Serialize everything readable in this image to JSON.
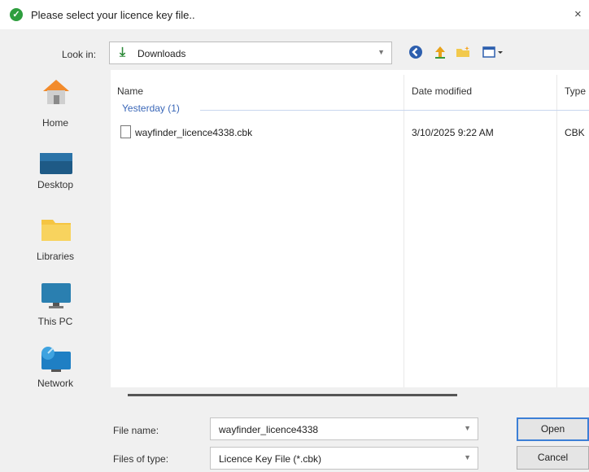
{
  "dialog": {
    "title": "Please select your licence key file..",
    "close_glyph": "×"
  },
  "toolbar": {
    "look_in_label": "Look in:",
    "look_in_value": "Downloads",
    "icons": [
      "back-icon",
      "up-folder-icon",
      "new-folder-icon",
      "view-menu-icon"
    ]
  },
  "places": [
    {
      "label": "Home",
      "icon": "home-icon"
    },
    {
      "label": "Desktop",
      "icon": "desktop-icon"
    },
    {
      "label": "Libraries",
      "icon": "libraries-icon"
    },
    {
      "label": "This PC",
      "icon": "this-pc-icon"
    },
    {
      "label": "Network",
      "icon": "network-icon"
    }
  ],
  "listing": {
    "columns": {
      "name": "Name",
      "date": "Date modified",
      "type": "Type"
    },
    "group": "Yesterday (1)",
    "files": [
      {
        "name": "wayfinder_licence4338.cbk",
        "date": "3/10/2025 9:22 AM",
        "type": "CBK"
      }
    ]
  },
  "footer": {
    "file_name_label": "File name:",
    "file_name_value": "wayfinder_licence4338",
    "file_type_label": "Files of type:",
    "file_type_value": "Licence Key File (*.cbk)",
    "open_label": "Open",
    "cancel_label": "Cancel"
  },
  "colors": {
    "accent": "#3c7fd6",
    "group_header": "#3a67b8",
    "title_check": "#2e9e3e"
  }
}
